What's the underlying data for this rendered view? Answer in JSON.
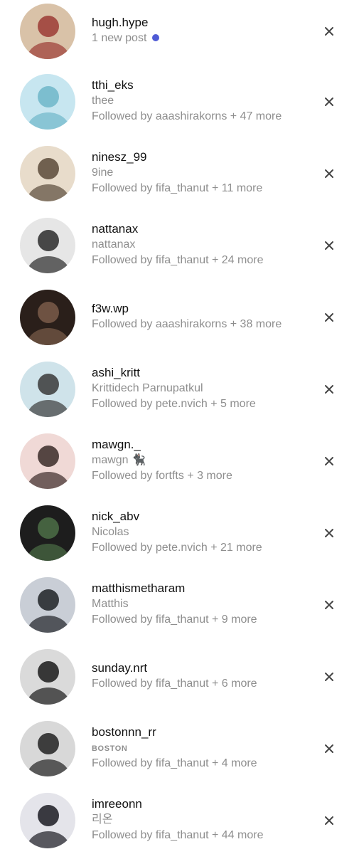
{
  "suggestions": [
    {
      "username": "hugh.hype",
      "line1": "1 new post",
      "line2": "",
      "new_post": true,
      "avatar_bg": "#d9c2a8",
      "avatar_fg": "#9b3b35"
    },
    {
      "username": "tthi_eks",
      "line1": "thee",
      "line2": "Followed by aaashirakorns + 47 more",
      "new_post": false,
      "avatar_bg": "#c7e6f0",
      "avatar_fg": "#6fb6c9"
    },
    {
      "username": "ninesz_99",
      "line1": "9ine",
      "line2": "Followed by fifa_thanut + 11 more",
      "new_post": false,
      "avatar_bg": "#e8dccb",
      "avatar_fg": "#5a4a3a"
    },
    {
      "username": "nattanax",
      "line1": "nattanax",
      "line2": "Followed by fifa_thanut + 24 more",
      "new_post": false,
      "avatar_bg": "#e6e6e6",
      "avatar_fg": "#2a2a2a"
    },
    {
      "username": "f3w.wp",
      "line1": "Followed by aaashirakorns + 38 more",
      "line2": "",
      "new_post": false,
      "avatar_bg": "#2a1f1a",
      "avatar_fg": "#7a5c4a"
    },
    {
      "username": "ashi_kritt",
      "line1": "Krittidech Parnupatkul",
      "line2": "Followed by pete.nvich + 5 more",
      "new_post": false,
      "avatar_bg": "#cfe3ea",
      "avatar_fg": "#3a3a3a"
    },
    {
      "username": "mawgn._",
      "line1": "mawgn 🐈‍⬛",
      "line2": "Followed by fortfts + 3 more",
      "new_post": false,
      "avatar_bg": "#f0d9d6",
      "avatar_fg": "#3a2a28"
    },
    {
      "username": "nick_abv",
      "line1": "Nicolas",
      "line2": "Followed by pete.nvich + 21 more",
      "new_post": false,
      "avatar_bg": "#1d1d1d",
      "avatar_fg": "#4c6e46"
    },
    {
      "username": "matthismetharam",
      "line1": "Matthis",
      "line2": "Followed by fifa_thanut + 9 more",
      "new_post": false,
      "avatar_bg": "#c9ced6",
      "avatar_fg": "#1f2226"
    },
    {
      "username": "sunday.nrt",
      "line1": "Followed by fifa_thanut + 6 more",
      "line2": "",
      "new_post": false,
      "avatar_bg": "#dadada",
      "avatar_fg": "#1a1a1a"
    },
    {
      "username": "bostonnn_rr",
      "line1": "BOSTON",
      "line2": "Followed by fifa_thanut + 4 more",
      "new_post": false,
      "small_caps": true,
      "avatar_bg": "#d8d8d8",
      "avatar_fg": "#222222"
    },
    {
      "username": "imreeonn",
      "line1": "리온",
      "line2": "Followed by fifa_thanut + 44 more",
      "new_post": false,
      "avatar_bg": "#e4e4ea",
      "avatar_fg": "#1b1b22"
    }
  ],
  "icons": {
    "dismiss": "close-icon"
  },
  "colors": {
    "text_primary": "#111111",
    "text_secondary": "#8e8e8e",
    "new_post_dot": "#4f5bd5"
  }
}
